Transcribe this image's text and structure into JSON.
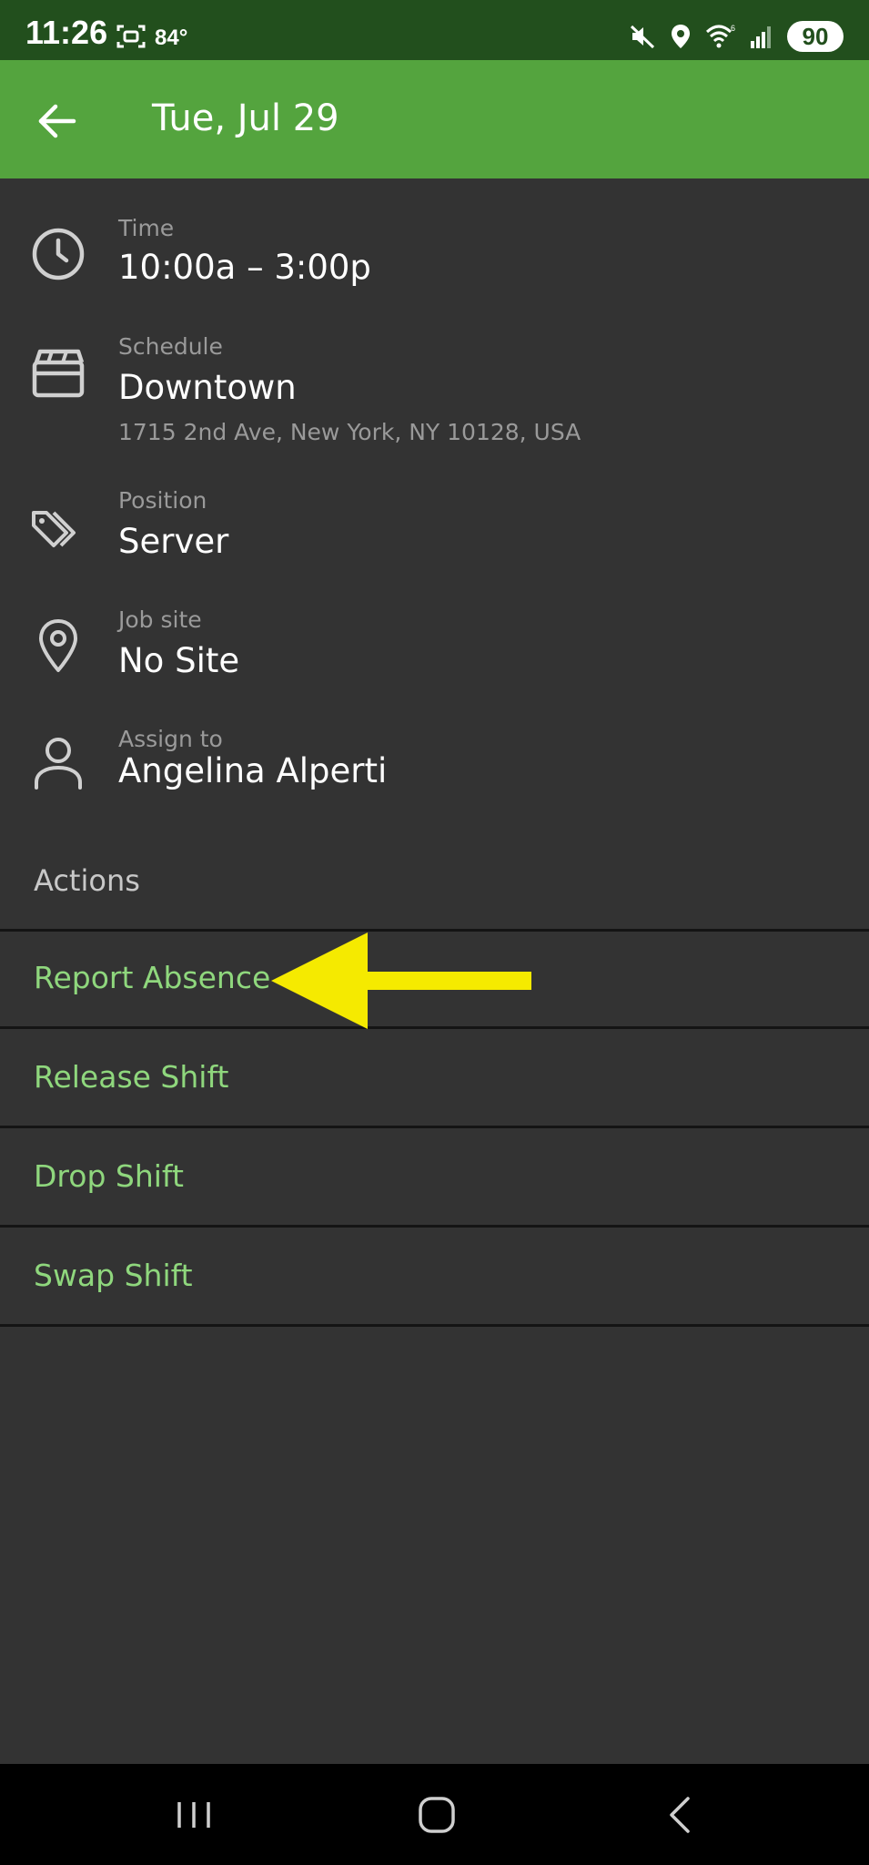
{
  "status_bar": {
    "time": "11:26",
    "temperature": "84°",
    "battery": "90",
    "icons": [
      "screenshot-icon",
      "mute-icon",
      "location-icon",
      "wifi-icon",
      "signal-icon"
    ]
  },
  "app_bar": {
    "title": "Tue, Jul 29",
    "back_icon": "arrow-left-icon",
    "color": "#54a43e"
  },
  "details": [
    {
      "icon": "clock-icon",
      "label": "Time",
      "value": "10:00a – 3:00p"
    },
    {
      "icon": "clapperboard-icon",
      "label": "Schedule",
      "value": "Downtown",
      "sub": "1715 2nd Ave, New York, NY 10128, USA"
    },
    {
      "icon": "tag-icon",
      "label": "Position",
      "value": "Server"
    },
    {
      "icon": "map-pin-icon",
      "label": "Job site",
      "value": "No Site"
    },
    {
      "icon": "person-icon",
      "label": "Assign to",
      "value": "Angelina Alperti"
    }
  ],
  "actions": {
    "header": "Actions",
    "items": [
      {
        "label": "Report Absence"
      },
      {
        "label": "Release Shift"
      },
      {
        "label": "Drop Shift"
      },
      {
        "label": "Swap Shift"
      }
    ],
    "color": "#8fd77d"
  },
  "annotation": {
    "icon": "yellow-arrow-icon",
    "color": "#f5ea00"
  },
  "nav_bar": {
    "icons": [
      "recent-apps-icon",
      "home-icon",
      "back-nav-icon"
    ]
  }
}
